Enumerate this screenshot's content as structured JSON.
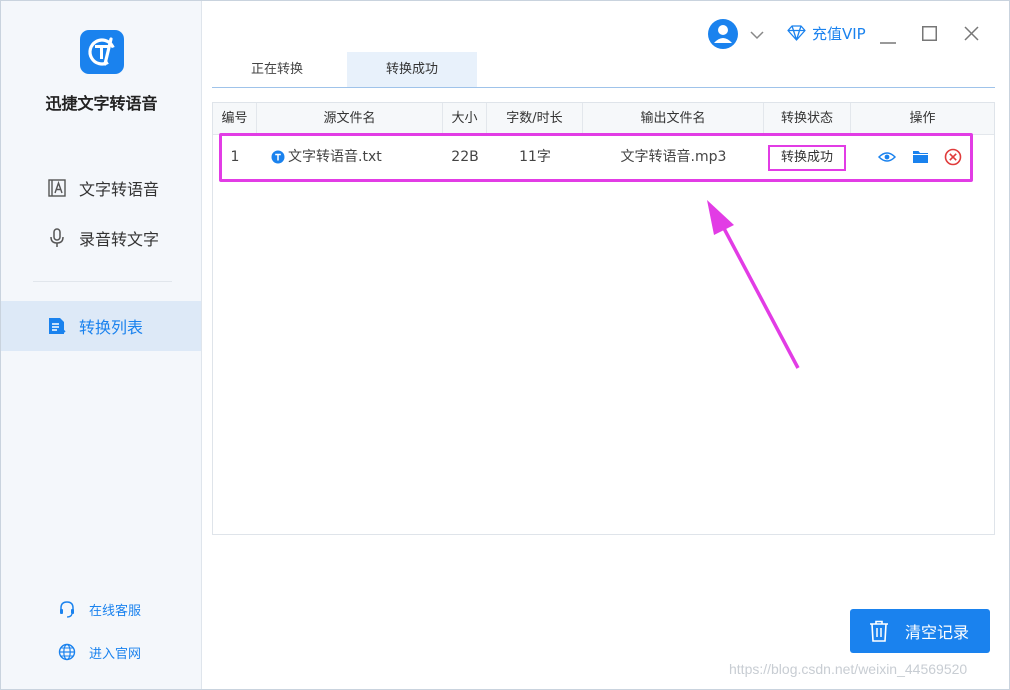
{
  "app": {
    "name": "迅捷文字转语音"
  },
  "sidebar": {
    "items": [
      {
        "label": "文字转语音",
        "icon": "text-document-icon"
      },
      {
        "label": "录音转文字",
        "icon": "microphone-icon"
      },
      {
        "label": "转换列表",
        "icon": "list-document-icon",
        "active": true
      }
    ],
    "footer": [
      {
        "label": "在线客服",
        "icon": "headset-icon"
      },
      {
        "label": "进入官网",
        "icon": "globe-icon"
      }
    ]
  },
  "titlebar": {
    "vip_label": "充值VIP"
  },
  "tabs": [
    {
      "label": "正在转换",
      "active": false
    },
    {
      "label": "转换成功",
      "active": true
    }
  ],
  "table": {
    "headers": [
      "编号",
      "源文件名",
      "大小",
      "字数/时长",
      "输出文件名",
      "转换状态",
      "操作"
    ],
    "rows": [
      {
        "id": "1",
        "source": "文字转语音.txt",
        "size": "22B",
        "length": "11字",
        "output": "文字转语音.mp3",
        "status": "转换成功"
      }
    ]
  },
  "clear_button": {
    "label": "清空记录"
  },
  "watermark": "https://blog.csdn.net/weixin_44569520",
  "colors": {
    "accent": "#1a82ee",
    "highlight": "#e23ce5",
    "delete": "#e03b3b"
  }
}
